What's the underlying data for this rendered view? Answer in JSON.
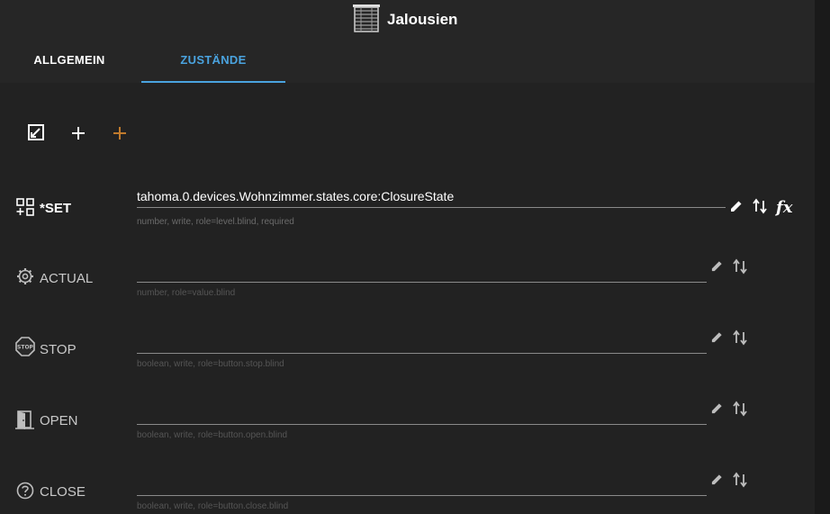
{
  "header": {
    "title": "Jalousien",
    "icon": "window-blind-icon"
  },
  "tabs": [
    {
      "label": "ALLGEMEIN",
      "active": false
    },
    {
      "label": "ZUSTÄNDE",
      "active": true
    }
  ],
  "toolbar": {
    "buttons": [
      "resize-icon",
      "add-icon",
      "add-custom-icon"
    ]
  },
  "states": [
    {
      "name": "*SET",
      "icon": "grid-plus-icon",
      "value": "tahoma.0.devices.Wohnzimmer.states.core:ClosureState",
      "help": "number, write, role=level.blind, required",
      "active": true
    },
    {
      "name": "ACTUAL",
      "icon": "gear-icon",
      "value": "",
      "help": "number, role=value.blind",
      "active": false
    },
    {
      "name": "STOP",
      "icon": "stop-sign-icon",
      "icon_text": "STOP",
      "value": "",
      "help": "boolean, write, role=button.stop.blind",
      "active": false
    },
    {
      "name": "OPEN",
      "icon": "door-open-icon",
      "value": "",
      "help": "boolean, write, role=button.open.blind",
      "active": false
    },
    {
      "name": "CLOSE",
      "icon": "help-circle-icon",
      "value": "",
      "help": "boolean, write, role=button.close.blind",
      "active": false
    }
  ],
  "actions": {
    "formula_label": "fx"
  },
  "colors": {
    "accent": "#4aa3df",
    "add_custom": "#c07a2c",
    "background": "#1e1e1e"
  }
}
